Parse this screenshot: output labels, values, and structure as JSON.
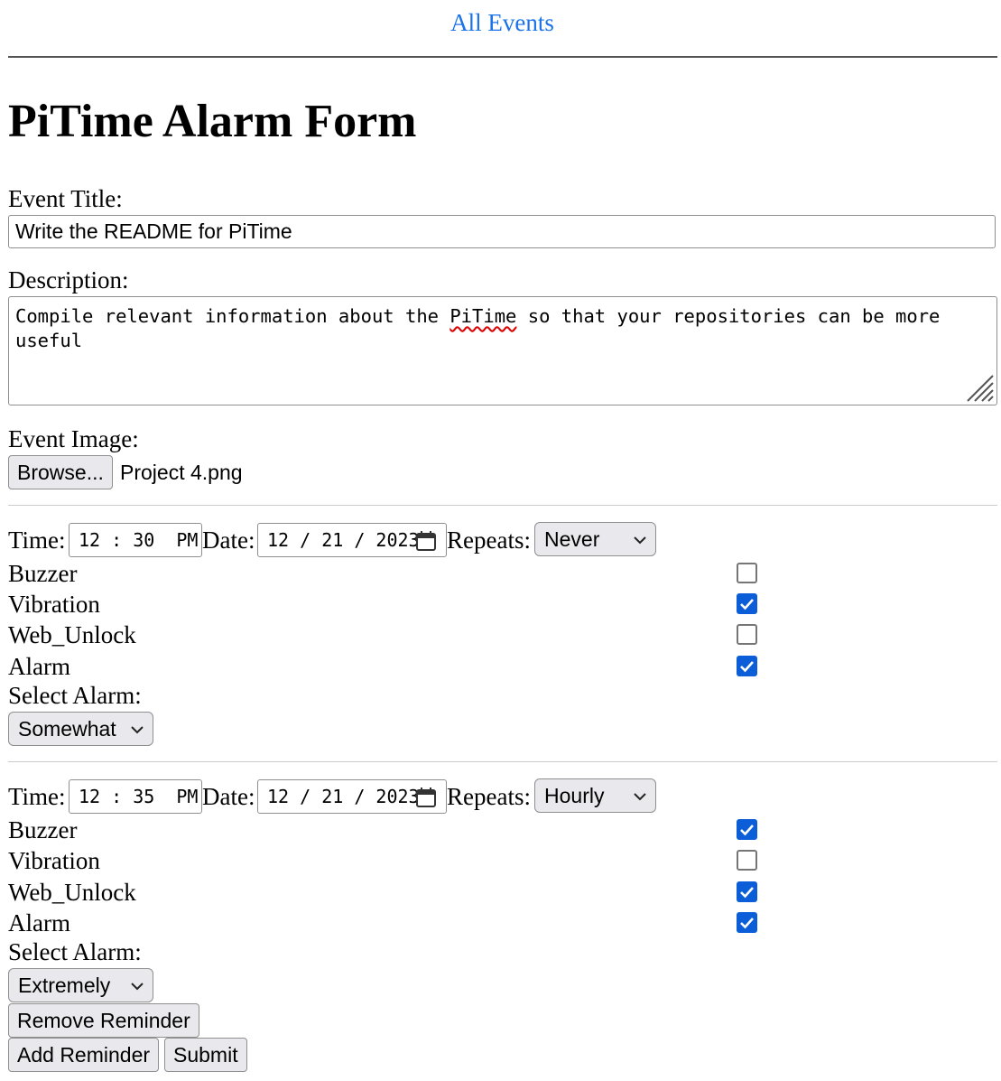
{
  "nav": {
    "all_events": "All Events"
  },
  "page_title": "PiTime Alarm Form",
  "event_title": {
    "label": "Event Title:",
    "value": "Write the README for PiTime"
  },
  "description": {
    "label": "Description:",
    "before": "Compile relevant information about the ",
    "misspelled": "PiTime",
    "after": " so that your repositories can be more\nuseful"
  },
  "event_image": {
    "label": "Event Image:",
    "browse_label": "Browse...",
    "file_name": "Project 4.png"
  },
  "reminders": [
    {
      "time_label": "Time:",
      "time_value": "12 : 30  PM",
      "date_label": "Date:",
      "date_value": "12 / 21 / 2023",
      "repeats_label": "Repeats:",
      "repeats_value": "Never",
      "options": [
        {
          "label": "Buzzer",
          "checked": false
        },
        {
          "label": "Vibration",
          "checked": true
        },
        {
          "label": "Web_Unlock",
          "checked": false
        },
        {
          "label": "Alarm",
          "checked": true
        }
      ],
      "select_alarm_label": "Select Alarm:",
      "select_alarm_value": "Somewhat"
    },
    {
      "time_label": "Time:",
      "time_value": "12 : 35  PM",
      "date_label": "Date:",
      "date_value": "12 / 21 / 2023",
      "repeats_label": "Repeats:",
      "repeats_value": "Hourly",
      "options": [
        {
          "label": "Buzzer",
          "checked": true
        },
        {
          "label": "Vibration",
          "checked": false
        },
        {
          "label": "Web_Unlock",
          "checked": true
        },
        {
          "label": "Alarm",
          "checked": true
        }
      ],
      "select_alarm_label": "Select Alarm:",
      "select_alarm_value": "Extremely",
      "remove_label": "Remove Reminder"
    }
  ],
  "actions": {
    "add_reminder": "Add Reminder",
    "submit": "Submit"
  },
  "colors": {
    "link": "#1a73e8",
    "checkbox": "#0b5ed7"
  }
}
